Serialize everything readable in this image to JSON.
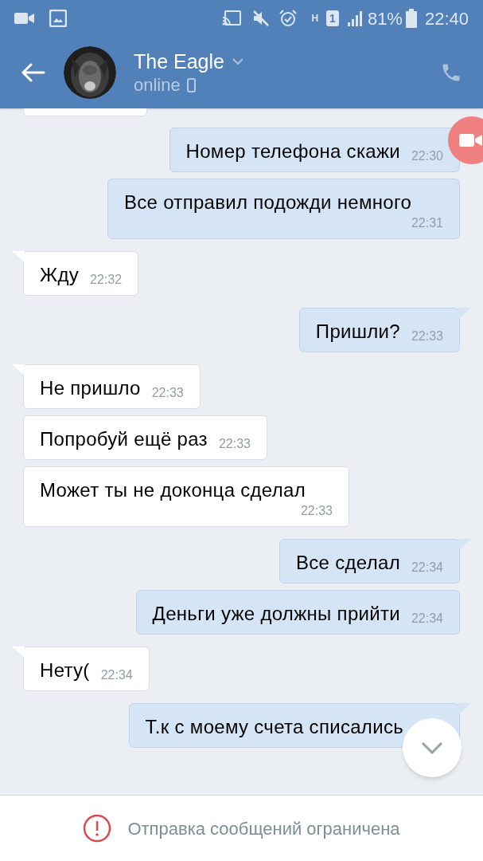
{
  "status_bar": {
    "network": "H",
    "sim": "1",
    "battery": "81%",
    "time": "22:40"
  },
  "header": {
    "name": "The Eagle",
    "presence": "online"
  },
  "messages": [
    {
      "kind": "outgoing",
      "tail": false,
      "text": "Номер телефона скажи",
      "time": "22:30"
    },
    {
      "kind": "outgoing",
      "tail": false,
      "text": "Все отправил подожди немного",
      "time": "22:31"
    },
    {
      "kind": "incoming",
      "tail": true,
      "text": "Жду",
      "time": "22:32"
    },
    {
      "kind": "outgoing",
      "tail": true,
      "text": "Пришли?",
      "time": "22:33"
    },
    {
      "kind": "incoming",
      "tail": true,
      "text": "Не пришло",
      "time": "22:33"
    },
    {
      "kind": "incoming",
      "tail": false,
      "text": "Попробуй ещё раз",
      "time": "22:33"
    },
    {
      "kind": "incoming",
      "tail": false,
      "text": "Может ты не доконца сделал",
      "time": "22:33"
    },
    {
      "kind": "outgoing",
      "tail": true,
      "text": "Все сделал",
      "time": "22:34"
    },
    {
      "kind": "outgoing",
      "tail": false,
      "text": "Деньги уже должны прийти",
      "time": "22:34"
    },
    {
      "kind": "incoming",
      "tail": true,
      "text": "Нету(",
      "time": "22:34"
    },
    {
      "kind": "outgoing",
      "tail": true,
      "text": "Т.к с моему счета списались"
    }
  ],
  "notice": {
    "text": "Отправка сообщений ограничена"
  }
}
